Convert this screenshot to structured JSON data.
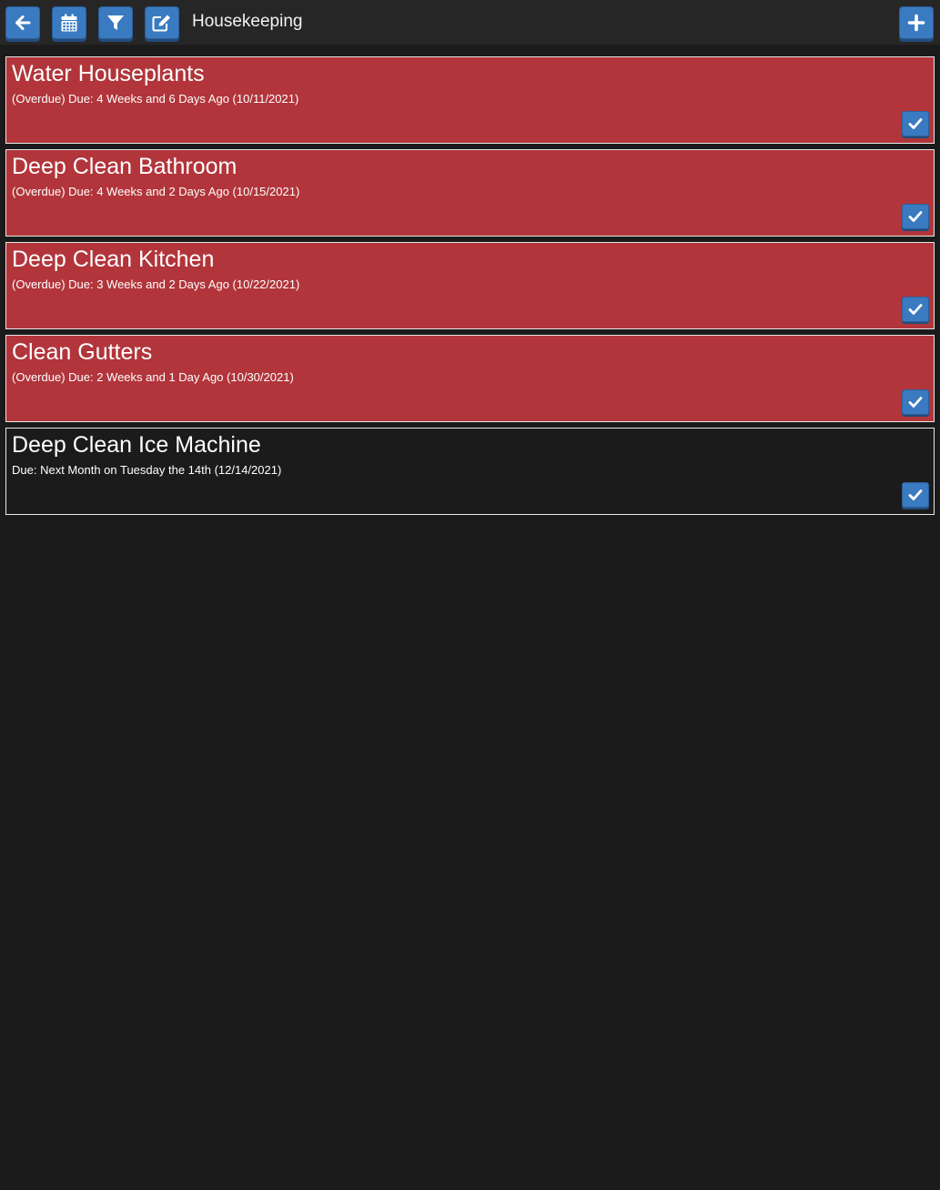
{
  "header": {
    "title": "Housekeeping",
    "buttons": [
      {
        "name": "back-button",
        "icon": "arrow-left-icon"
      },
      {
        "name": "calendar-button",
        "icon": "calendar-icon"
      },
      {
        "name": "filter-button",
        "icon": "filter-icon"
      },
      {
        "name": "edit-button",
        "icon": "edit-icon"
      },
      {
        "name": "add-button",
        "icon": "plus-icon"
      }
    ]
  },
  "tasks": [
    {
      "title": "Water Houseplants",
      "due": "(Overdue) Due: 4 Weeks and 6 Days Ago (10/11/2021)",
      "overdue": true
    },
    {
      "title": "Deep Clean Bathroom",
      "due": "(Overdue) Due: 4 Weeks and 2 Days Ago (10/15/2021)",
      "overdue": true
    },
    {
      "title": "Deep Clean Kitchen",
      "due": "(Overdue) Due: 3 Weeks and 2 Days Ago (10/22/2021)",
      "overdue": true
    },
    {
      "title": "Clean Gutters",
      "due": "(Overdue) Due: 2 Weeks and 1 Day Ago (10/30/2021)",
      "overdue": true
    },
    {
      "title": "Deep Clean Ice Machine",
      "due": "Due: Next Month on Tuesday the 14th (12/14/2021)",
      "overdue": false
    }
  ],
  "colors": {
    "background": "#1b1b1b",
    "topbar": "#262626",
    "overdue": "#b1353b",
    "button": "#3a7ac0"
  }
}
